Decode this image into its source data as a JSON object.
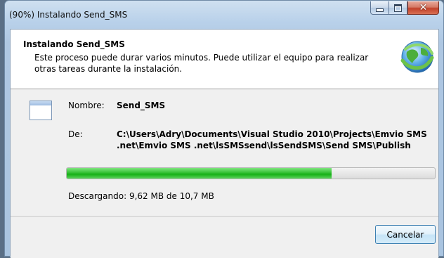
{
  "window": {
    "title": "(90%) Instalando Send_SMS"
  },
  "header": {
    "title": "Instalando Send_SMS",
    "description": "Este proceso puede durar varios minutos. Puede utilizar el equipo para realizar otras tareas durante la instalación.",
    "icon": "installer-globe-icon"
  },
  "details": {
    "name_label": "Nombre:",
    "name_value": "Send_SMS",
    "from_label": "De:",
    "from_value": "C:\\Users\\Adry\\Documents\\Visual Studio 2010\\Projects\\Emvio SMS\n.net\\Emvio SMS .net\\lsSMSsend\\lsSendSMS\\Send SMS\\Publish"
  },
  "progress": {
    "fraction": 0.72,
    "status": "Descargando: 9,62 MB de 10,7 MB",
    "fill_color": "#16b016"
  },
  "buttons": {
    "cancel": "Cancelar"
  }
}
